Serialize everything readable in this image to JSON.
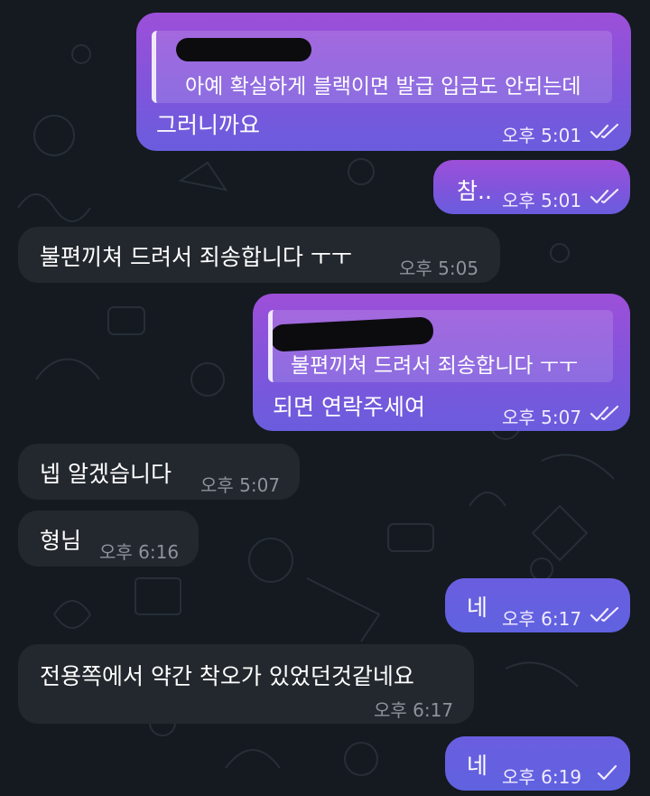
{
  "messages": [
    {
      "id": "m1",
      "direction": "out",
      "reply_quote": "아예 확실하게 블랙이면 발급 입금도 안되는데",
      "text": "그러니까요",
      "time": "오후 5:01",
      "status": "read",
      "status_icon": "double-check-icon"
    },
    {
      "id": "m2",
      "direction": "out",
      "text": "참..",
      "time": "오후 5:01",
      "status": "read",
      "status_icon": "double-check-icon"
    },
    {
      "id": "m3",
      "direction": "in",
      "text": "불편끼쳐 드려서 죄송합니다 ㅜㅜ",
      "time": "오후 5:05"
    },
    {
      "id": "m4",
      "direction": "out",
      "reply_quote": "불편끼쳐 드려서 죄송합니다 ㅜㅜ",
      "text": "되면 연락주세여",
      "time": "오후 5:07",
      "status": "read",
      "status_icon": "double-check-icon"
    },
    {
      "id": "m5",
      "direction": "in",
      "text": "넵 알겠습니다",
      "time": "오후 5:07"
    },
    {
      "id": "m6",
      "direction": "in",
      "text": "형님",
      "time": "오후 6:16"
    },
    {
      "id": "m7",
      "direction": "out",
      "text": "네",
      "time": "오후 6:17",
      "status": "read",
      "status_icon": "double-check-icon"
    },
    {
      "id": "m8",
      "direction": "in",
      "text": "전용쪽에서 약간 착오가 있었던것같네요",
      "time": "오후 6:17"
    },
    {
      "id": "m9",
      "direction": "out",
      "text": "네",
      "time": "오후 6:19",
      "status": "sent",
      "status_icon": "single-check-icon"
    }
  ],
  "colors": {
    "background": "#141a20",
    "outgoing_bubble_top": "#9d4fd8",
    "outgoing_bubble_bottom": "#6a5ddd",
    "incoming_bubble": "#23282e",
    "incoming_time": "#8c939b"
  }
}
